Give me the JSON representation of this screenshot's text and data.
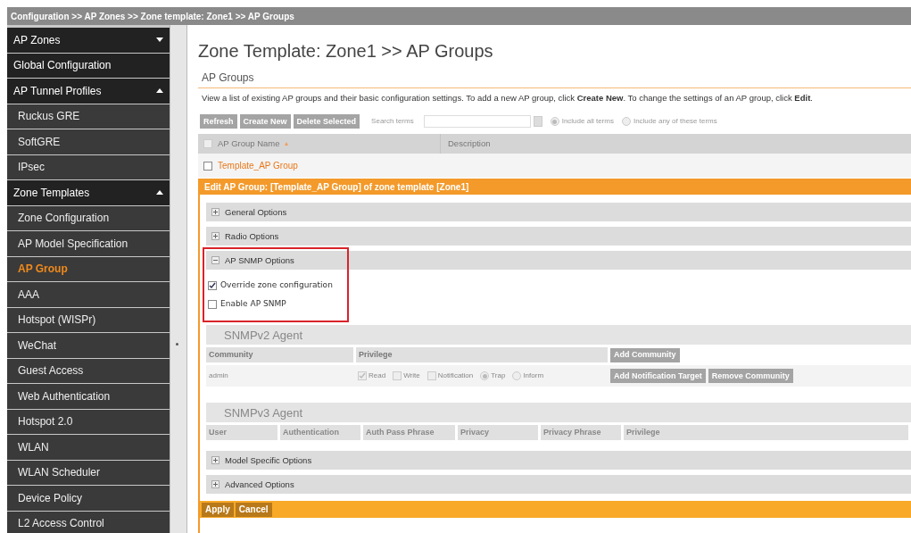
{
  "breadcrumb": "Configuration >> AP Zones >> Zone template: Zone1 >> AP Groups",
  "sidebar": {
    "items": [
      {
        "kind": "section",
        "label": "AP Zones",
        "expanded": false,
        "selected": false
      },
      {
        "kind": "section",
        "label": "Global Configuration",
        "selected": false
      },
      {
        "kind": "section",
        "label": "AP Tunnel Profiles",
        "expanded": true,
        "selected": false
      },
      {
        "kind": "link",
        "label": "Ruckus GRE",
        "selected": false
      },
      {
        "kind": "link",
        "label": "SoftGRE",
        "selected": false
      },
      {
        "kind": "link",
        "label": "IPsec",
        "selected": false
      },
      {
        "kind": "section",
        "label": "Zone Templates",
        "expanded": true,
        "selected": false
      },
      {
        "kind": "link",
        "label": "Zone Configuration",
        "selected": false
      },
      {
        "kind": "link",
        "label": "AP Model Specification",
        "selected": false
      },
      {
        "kind": "link",
        "label": "AP Group",
        "selected": true
      },
      {
        "kind": "link",
        "label": "AAA",
        "selected": false
      },
      {
        "kind": "link",
        "label": "Hotspot (WISPr)",
        "selected": false
      },
      {
        "kind": "link",
        "label": "WeChat",
        "selected": false
      },
      {
        "kind": "link",
        "label": "Guest Access",
        "selected": false
      },
      {
        "kind": "link",
        "label": "Web Authentication",
        "selected": false
      },
      {
        "kind": "link",
        "label": "Hotspot 2.0",
        "selected": false
      },
      {
        "kind": "link",
        "label": "WLAN",
        "selected": false
      },
      {
        "kind": "link",
        "label": "WLAN Scheduler",
        "selected": false
      },
      {
        "kind": "link",
        "label": "Device Policy",
        "selected": false
      },
      {
        "kind": "link",
        "label": "L2 Access Control",
        "selected": false
      }
    ]
  },
  "page_title": "Zone Template: Zone1 >> AP Groups",
  "section_title": "AP Groups",
  "description": "View a list of existing AP groups and their basic configuration settings. To add a new AP group, click **Create New**. To change the settings of an AP group, click **Edit**.",
  "toolbar": {
    "buttons": [
      {
        "label": "Refresh",
        "disabled": true
      },
      {
        "label": "Create New",
        "disabled": true
      },
      {
        "label": "Delete Selected",
        "disabled": true
      }
    ],
    "search_label": "Search terms",
    "options": [
      {
        "label": "Include all terms",
        "selected": true
      },
      {
        "label": "Include any of these terms",
        "selected": false
      }
    ]
  },
  "table": {
    "select_all": {
      "checked": false
    },
    "columns": [
      "AP Group Name",
      "Description"
    ],
    "sort_indicator": "▲",
    "rows": [
      {
        "name": "Template_AP Group",
        "checked": false
      }
    ]
  },
  "edit_panel": {
    "title": "Edit AP Group: [Template_AP Group] of zone template [Zone1]",
    "sections_before": [
      {
        "label": "General Options",
        "expanded": false
      },
      {
        "label": "Radio Options",
        "expanded": false
      },
      {
        "label": "AP SNMP Options",
        "expanded": true
      }
    ],
    "snmp_options": [
      {
        "label": "Override zone configuration",
        "checked": true
      },
      {
        "label": "Enable AP SNMP",
        "checked": false
      }
    ],
    "snmpv2": {
      "title": "SNMPv2 Agent",
      "columns": [
        "Community",
        "Privilege"
      ],
      "add_button": "Add Community",
      "row": {
        "community": "admin",
        "privileges": [
          {
            "kind": "checkbox",
            "label": "Read",
            "checked": true
          },
          {
            "kind": "checkbox",
            "label": "Write",
            "checked": false
          },
          {
            "kind": "checkbox",
            "label": "Notification",
            "checked": false
          },
          {
            "kind": "radio",
            "label": "Trap",
            "checked": true
          },
          {
            "kind": "radio",
            "label": "Inform",
            "checked": false
          }
        ],
        "buttons": [
          "Add Notification Target",
          "Remove Community"
        ]
      }
    },
    "snmpv3": {
      "title": "SNMPv3 Agent",
      "columns": [
        "User",
        "Authentication",
        "Auth Pass Phrase",
        "Privacy",
        "Privacy Phrase",
        "Privilege"
      ]
    },
    "sections_after": [
      {
        "label": "Model Specific Options",
        "expanded": false
      },
      {
        "label": "Advanced Options",
        "expanded": false
      }
    ],
    "footer_buttons": [
      "Apply",
      "Cancel"
    ]
  }
}
